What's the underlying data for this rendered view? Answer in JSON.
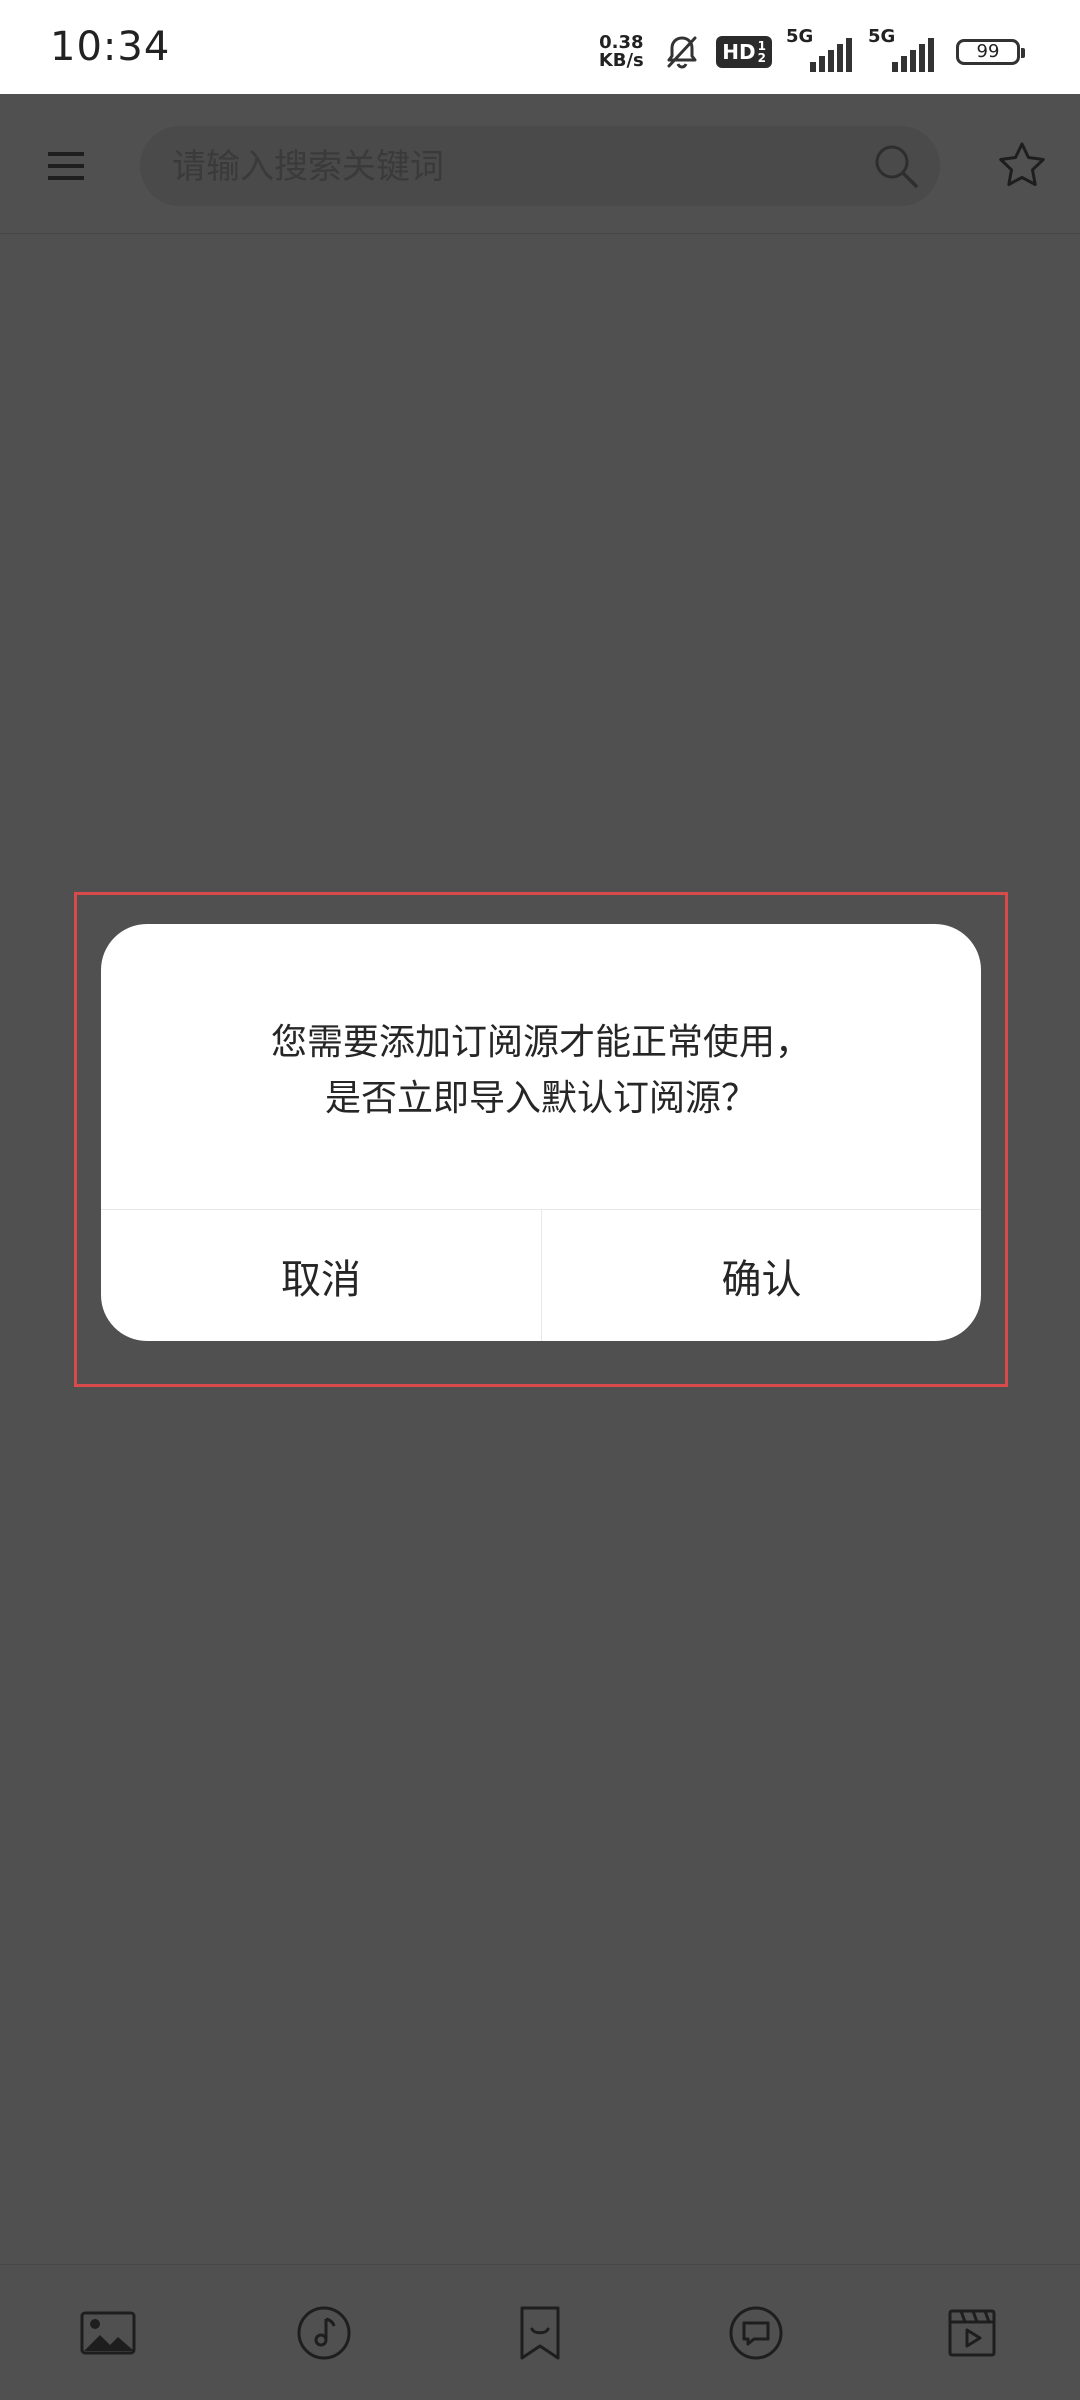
{
  "status_bar": {
    "time": "10:34",
    "net_speed_value": "0.38",
    "net_speed_unit": "KB/s",
    "hd_label": "HD",
    "hd_sub": "1",
    "hd_sub2": "2",
    "signal1_label": "5G",
    "signal2_label": "5G",
    "battery": "99"
  },
  "header": {
    "search_placeholder": "请输入搜索关键词",
    "icons": [
      "menu-icon",
      "search-icon",
      "star-icon"
    ]
  },
  "dialog": {
    "message_line1": "您需要添加订阅源才能正常使用，",
    "message_line2": "是否立即导入默认订阅源？",
    "cancel_label": "取消",
    "confirm_label": "确认"
  },
  "bottom_nav": {
    "items": [
      "image-icon",
      "music-icon",
      "bookmark-icon",
      "chat-icon",
      "video-icon"
    ]
  },
  "colors": {
    "overlay": "#505050",
    "dialog_bg": "#ffffff",
    "highlight": "#d94a4a",
    "text": "#262626"
  }
}
